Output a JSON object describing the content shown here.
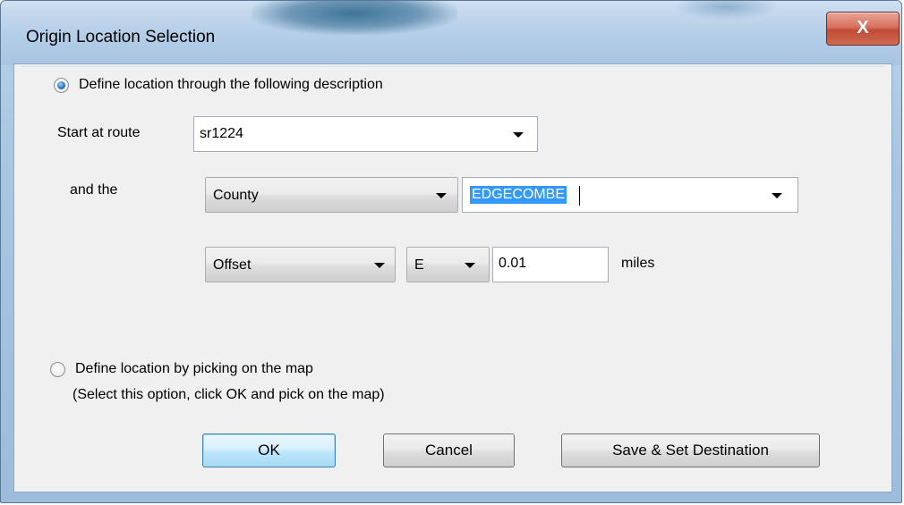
{
  "window": {
    "title": "Origin Location Selection",
    "close_glyph": "X"
  },
  "option_description": {
    "label": "Define location through the following description",
    "selected": true
  },
  "route": {
    "label": "Start at route",
    "value": "sr1224"
  },
  "reference": {
    "label": "and the",
    "type_value": "County",
    "name_value": "EDGECOMBE"
  },
  "offset": {
    "mode_value": "Offset",
    "direction_value": "E",
    "distance_value": "0.01",
    "unit_label": "miles"
  },
  "option_map": {
    "label": "Define location by picking on the map",
    "hint": "(Select this option, click OK and pick on the map)",
    "selected": false
  },
  "buttons": {
    "ok": "OK",
    "cancel": "Cancel",
    "save_destination": "Save & Set Destination"
  },
  "icons": {
    "dropdown": "chevron-down-icon",
    "close": "close-icon"
  }
}
